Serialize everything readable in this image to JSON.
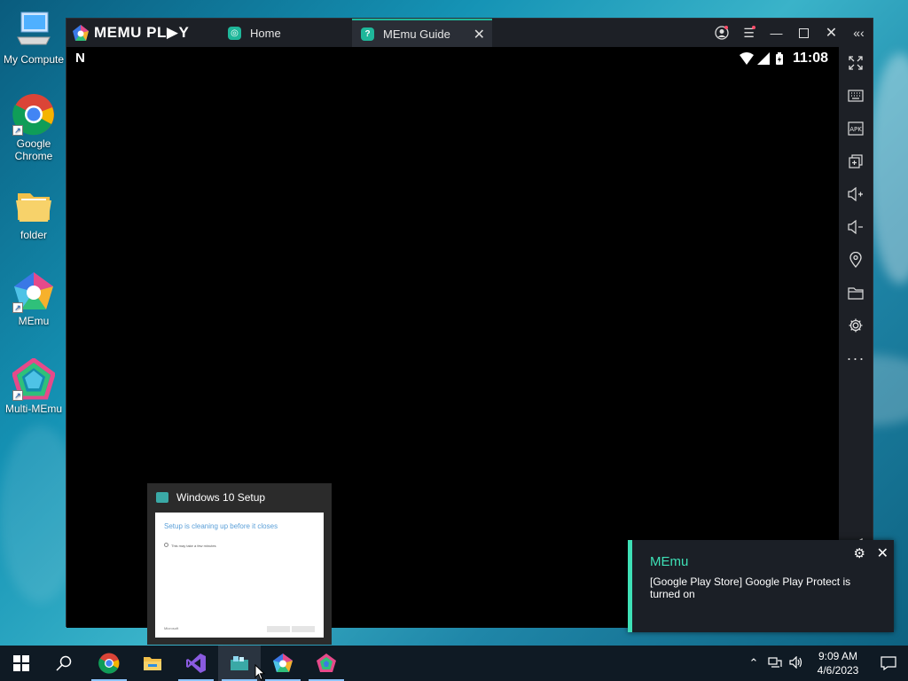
{
  "desktop": {
    "icons": [
      {
        "label": "My Compute",
        "icon": "computer-icon"
      },
      {
        "label": "Google Chrome",
        "icon": "chrome-icon"
      },
      {
        "label": "folder",
        "icon": "folder-icon"
      },
      {
        "label": "MEmu",
        "icon": "memu-icon"
      },
      {
        "label": "Multi-MEmu",
        "icon": "multi-memu-icon"
      }
    ]
  },
  "memu": {
    "brand": "MEMU PL▶Y",
    "tabs": [
      {
        "label": "Home",
        "icon": "home-icon"
      },
      {
        "label": "MEmu Guide",
        "icon": "guide-icon",
        "active": true
      }
    ],
    "status": {
      "time": "11:08"
    },
    "toolbar": [
      "fullscreen-icon",
      "keyboard-icon",
      "apk-icon",
      "multi-window-icon",
      "volume-up-icon",
      "volume-down-icon",
      "location-icon",
      "folder-icon",
      "settings-icon",
      "more-icon",
      "back-icon"
    ]
  },
  "thumbnail": {
    "title": "Windows 10 Setup",
    "heading": "Setup is cleaning up before it closes",
    "subtext": "This may take a few minutes",
    "footer": "Microsoft"
  },
  "toast": {
    "app": "MEmu",
    "message": "[Google Play Store] Google Play Protect is turned on"
  },
  "taskbar": {
    "apps": [
      "start-icon",
      "search-icon",
      "chrome-icon",
      "file-explorer-icon",
      "visual-studio-icon",
      "windows-setup-icon",
      "memu-icon",
      "multi-memu-icon"
    ],
    "clock": {
      "time": "9:09 AM",
      "date": "4/6/2023"
    }
  },
  "colors": {
    "accent": "#3ee0b6",
    "titlebar": "#1d2026",
    "taskbar": "#0f1a24"
  }
}
